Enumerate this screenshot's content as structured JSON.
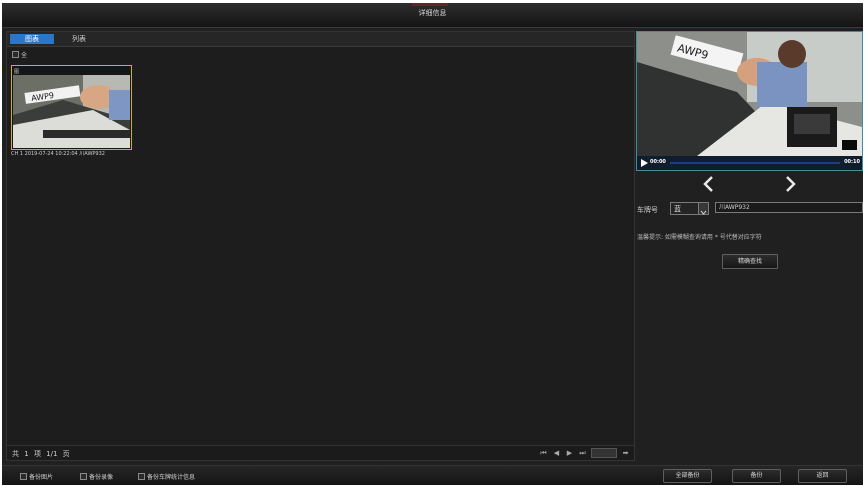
{
  "window": {
    "title": "详细信息"
  },
  "tabs": {
    "icon_view": "图表",
    "list_view": "列表"
  },
  "select_all_label": "全",
  "thumbnail": {
    "checkbox_label": "图",
    "caption": "CH 1 2019-07-24 10:22:04 川AWP932"
  },
  "footer": {
    "total_prefix": "共",
    "total_count": "1",
    "total_unit": "项",
    "page_value": "1/1",
    "page_unit": "页"
  },
  "player": {
    "current_time": "00:00",
    "total_time": "00:10",
    "progress_fraction": 0.0
  },
  "plate_search": {
    "label": "车牌号",
    "plate_color": "蓝",
    "plate_value": "川AWP932",
    "tip": "温馨提示: 如需模糊查询请用 * 号代替对应字符",
    "exact_search_label": "精确查找"
  },
  "bottom": {
    "backup_images_label": "备份图片",
    "backup_videos_label": "备份录像",
    "backup_stats_label": "备份车牌统计信息",
    "backup_all_label": "全部备份",
    "backup_label": "备份",
    "return_label": "返回"
  },
  "colors": {
    "accent_tab": "#2a77c9",
    "selected_border": "#d4b010",
    "preview_border": "#3f8e9e",
    "progress_track": "#1b3f86"
  },
  "icons": [
    "checkbox-icon",
    "play-icon",
    "prev-arrow-icon",
    "next-arrow-icon",
    "first-page-icon",
    "prev-page-icon",
    "next-page-icon",
    "last-page-icon",
    "go-icon",
    "dropdown-caret-icon"
  ]
}
